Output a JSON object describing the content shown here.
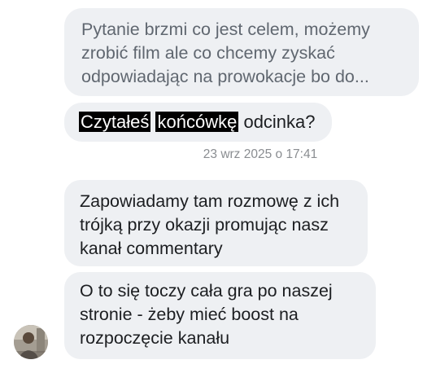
{
  "conversation": {
    "quoted_message": {
      "lines": [
        "Pytanie brzmi co jest celem, możemy",
        "zrobić film ale co chcemy zyskać",
        "odpowiadając na prowokacje bo do..."
      ]
    },
    "reply": {
      "word1": "Czytałeś",
      "word2": "końcówkę",
      "word3": "odcinka?"
    },
    "timestamp": "23 wrz 2025 o 17:41",
    "messages": [
      {
        "lines": [
          "Zapowiadamy tam rozmowę z ich",
          "trójką przy okazji promując nasz",
          "kanał commentary"
        ]
      },
      {
        "lines": [
          "O to się toczy cała gra po naszej",
          "stronie - żeby mieć boost na",
          "rozpoczęcie kanału"
        ]
      }
    ]
  },
  "colors": {
    "bubble_bg": "#eef0f3",
    "text": "#1c1e21",
    "quoted_text": "#606770",
    "timestamp": "#8a8d91",
    "highlight": "#000000"
  }
}
